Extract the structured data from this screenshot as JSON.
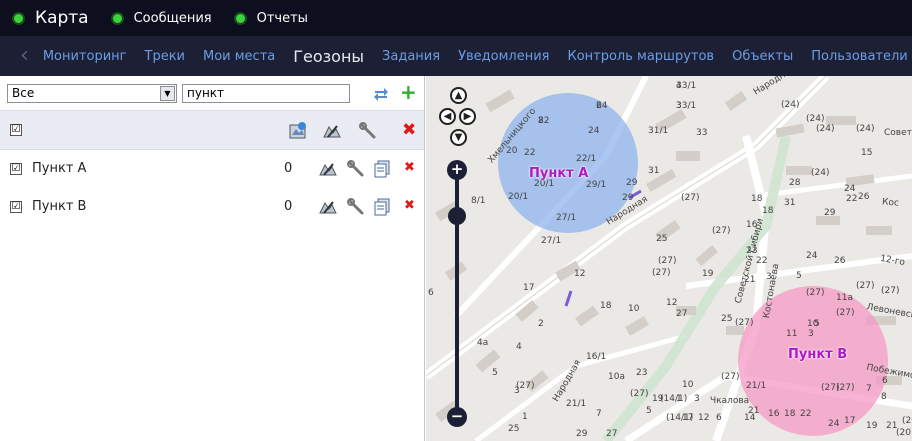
{
  "topbar": {
    "items": [
      {
        "label": "Карта",
        "selected": true
      },
      {
        "label": "Сообщения"
      },
      {
        "label": "Отчеты"
      }
    ]
  },
  "navbar": {
    "items": [
      {
        "label": "Мониторинг"
      },
      {
        "label": "Треки"
      },
      {
        "label": "Мои места"
      },
      {
        "label": "Геозоны",
        "active": true
      },
      {
        "label": "Задания"
      },
      {
        "label": "Уведомления"
      },
      {
        "label": "Контроль маршрутов"
      },
      {
        "label": "Объекты"
      },
      {
        "label": "Пользователи"
      }
    ]
  },
  "panel": {
    "filter_value": "Все",
    "search_value": "пункт",
    "header_checked": "☑",
    "rows": [
      {
        "name": "Пункт А",
        "count": "0",
        "checked": "☑"
      },
      {
        "name": "Пункт В",
        "count": "0",
        "checked": "☑"
      }
    ]
  },
  "map": {
    "zones": [
      {
        "label": "Пункт А",
        "color": "#8fb4ee"
      },
      {
        "label": "Пункт В",
        "color": "#f59ac6"
      }
    ],
    "streets": [
      "Народная",
      "Советской Сибири",
      "Костонаева",
      "Чкалова",
      "Побежимова",
      "Левоневского",
      "Советская",
      "Кос",
      "12-го",
      "Хмельницкого"
    ],
    "house_numbers": [
      "33/1",
      "33/1",
      "24",
      "22",
      "24",
      "31/1",
      "33",
      "20",
      "22",
      "22/1",
      "31",
      "20/1",
      "29/1",
      "29",
      "20/1",
      "29",
      "(27)",
      "18",
      "8/1",
      "27/1",
      "27/1",
      "(24)",
      "(24)",
      "(24)",
      "(24)",
      "15",
      "28",
      "(24)",
      "24",
      "26",
      "31",
      "22",
      "29",
      "25",
      "(27)",
      "16",
      "18",
      "23",
      "22",
      "24",
      "26",
      "(27)",
      "(27)",
      "19",
      "21",
      "3",
      "5",
      "(27)",
      "(27)",
      "12",
      "17",
      "18",
      "10",
      "12",
      "27",
      "25",
      "(27)",
      "(27)",
      "(27)",
      "11а",
      "11",
      "10",
      "3",
      "5",
      "6",
      "2",
      "4а",
      "4",
      "16/1",
      "23",
      "(27)",
      "21/1",
      "21",
      "(27)",
      "(27)",
      "7",
      "6",
      "8",
      "10",
      "10а",
      "(27)",
      "(27)",
      "3",
      "5",
      "21/1",
      "19",
      "(14/1)",
      "1",
      "3",
      "5",
      "7",
      "1",
      "(14/1)",
      "17",
      "12",
      "6",
      "14",
      "16",
      "18",
      "22",
      "24",
      "17",
      "19",
      "21",
      "25",
      "27",
      "29",
      "31",
      "17",
      "(14/1)",
      "4",
      "(20)",
      "(20)",
      "28",
      "32",
      "4",
      "3",
      "6",
      "8"
    ],
    "zoom_in": "+",
    "zoom_out": "−"
  },
  "colors": {
    "topbar_bg": "#0d0e1e",
    "navbar_bg": "#1d1f34",
    "nav_link": "#6a9ee6",
    "active_dot": "#3bd33b",
    "add_green": "#2eae2e",
    "delete_red": "#e0191b",
    "geozone_label": "#b316c5"
  },
  "icons": [
    "radio-dot-icon",
    "chevron-left-icon",
    "dropdown-arrow-icon",
    "swap-arrows-icon",
    "add-plus-icon",
    "geozone-new-icon",
    "geozone-props-icon",
    "wrench-icon",
    "delete-x-icon",
    "copy-icon",
    "pan-up-icon",
    "pan-left-icon",
    "pan-right-icon",
    "pan-down-icon",
    "zoom-in-icon",
    "zoom-out-icon"
  ]
}
